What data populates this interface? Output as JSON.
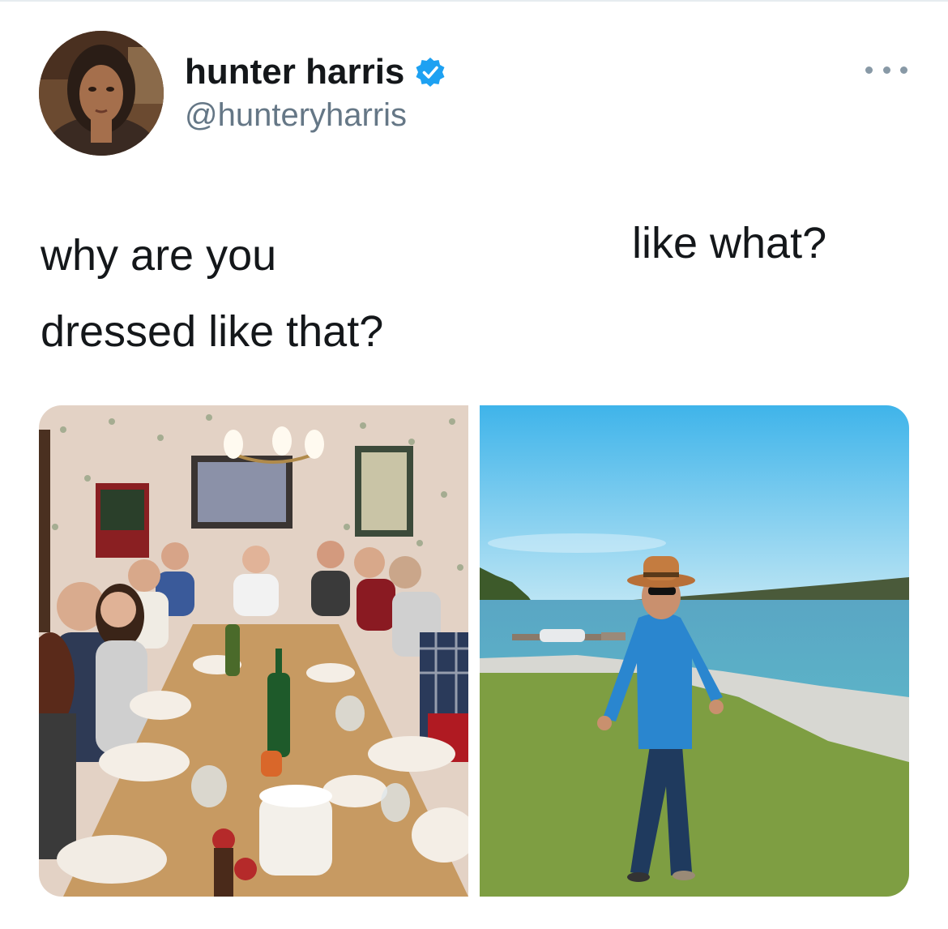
{
  "tweet": {
    "author": {
      "display_name": "hunter harris",
      "handle": "@hunteryharris",
      "verified": true,
      "verified_color": "#1da1f2"
    },
    "text_left": "why are you\ndressed like that?",
    "text_right": "like what?",
    "more_icon": "more-horizontal-icon",
    "media": [
      {
        "name": "dinner-party-photo"
      },
      {
        "name": "man-by-water-photo"
      }
    ]
  }
}
